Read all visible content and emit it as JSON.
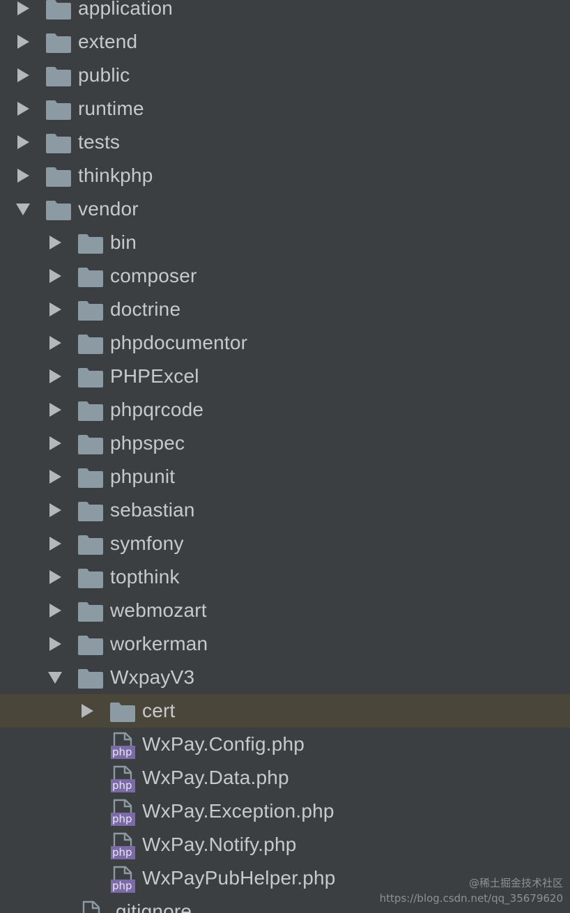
{
  "tree": [
    {
      "name": "application",
      "type": "folder",
      "level": 0,
      "expanded": false
    },
    {
      "name": "extend",
      "type": "folder",
      "level": 0,
      "expanded": false
    },
    {
      "name": "public",
      "type": "folder",
      "level": 0,
      "expanded": false
    },
    {
      "name": "runtime",
      "type": "folder",
      "level": 0,
      "expanded": false
    },
    {
      "name": "tests",
      "type": "folder",
      "level": 0,
      "expanded": false
    },
    {
      "name": "thinkphp",
      "type": "folder",
      "level": 0,
      "expanded": false
    },
    {
      "name": "vendor",
      "type": "folder",
      "level": 0,
      "expanded": true
    },
    {
      "name": "bin",
      "type": "folder",
      "level": 1,
      "expanded": false
    },
    {
      "name": "composer",
      "type": "folder",
      "level": 1,
      "expanded": false
    },
    {
      "name": "doctrine",
      "type": "folder",
      "level": 1,
      "expanded": false
    },
    {
      "name": "phpdocumentor",
      "type": "folder",
      "level": 1,
      "expanded": false
    },
    {
      "name": "PHPExcel",
      "type": "folder",
      "level": 1,
      "expanded": false
    },
    {
      "name": "phpqrcode",
      "type": "folder",
      "level": 1,
      "expanded": false
    },
    {
      "name": "phpspec",
      "type": "folder",
      "level": 1,
      "expanded": false
    },
    {
      "name": "phpunit",
      "type": "folder",
      "level": 1,
      "expanded": false
    },
    {
      "name": "sebastian",
      "type": "folder",
      "level": 1,
      "expanded": false
    },
    {
      "name": "symfony",
      "type": "folder",
      "level": 1,
      "expanded": false
    },
    {
      "name": "topthink",
      "type": "folder",
      "level": 1,
      "expanded": false
    },
    {
      "name": "webmozart",
      "type": "folder",
      "level": 1,
      "expanded": false
    },
    {
      "name": "workerman",
      "type": "folder",
      "level": 1,
      "expanded": false
    },
    {
      "name": "WxpayV3",
      "type": "folder",
      "level": 1,
      "expanded": true
    },
    {
      "name": "cert",
      "type": "folder",
      "level": 2,
      "expanded": false,
      "selected": true
    },
    {
      "name": "WxPay.Config.php",
      "type": "php",
      "level": 2
    },
    {
      "name": "WxPay.Data.php",
      "type": "php",
      "level": 2
    },
    {
      "name": "WxPay.Exception.php",
      "type": "php",
      "level": 2
    },
    {
      "name": "WxPay.Notify.php",
      "type": "php",
      "level": 2
    },
    {
      "name": "WxPayPubHelper.php",
      "type": "php",
      "level": 2
    },
    {
      "name": ".gitignore",
      "type": "text",
      "level": 1
    }
  ],
  "php_badge": "php",
  "watermark": {
    "line1": "@稀土掘金技术社区",
    "line2": "https://blog.csdn.net/qq_35679620"
  },
  "colors": {
    "background": "#3c3f41",
    "selected_row": "#4a4639",
    "text": "#c7cacd",
    "folder": "#8c9aa3",
    "arrow": "#b5b8bb",
    "php_badge": "#7b6aa8"
  }
}
